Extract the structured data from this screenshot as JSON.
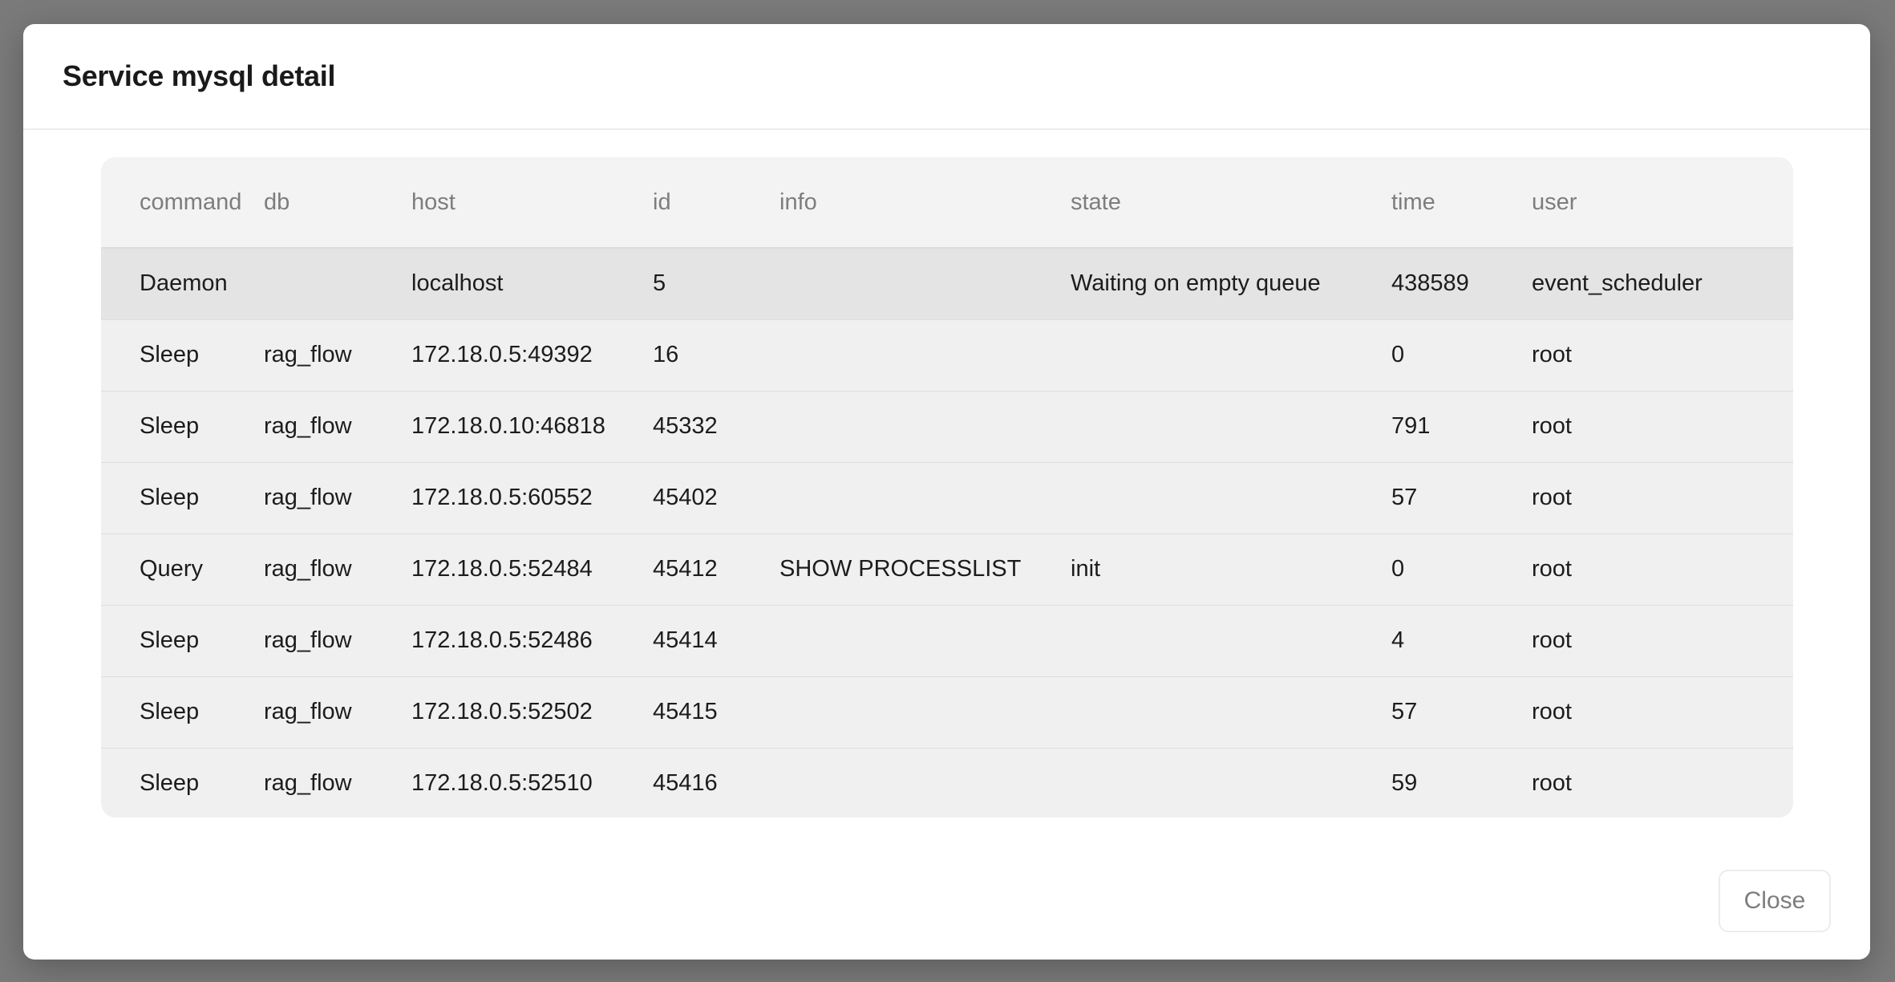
{
  "modal": {
    "title": "Service mysql detail",
    "close_label": "Close"
  },
  "table": {
    "columns": [
      "command",
      "db",
      "host",
      "id",
      "info",
      "state",
      "time",
      "user"
    ],
    "rows": [
      {
        "command": "Daemon",
        "db": "",
        "host": "localhost",
        "id": "5",
        "info": "",
        "state": "Waiting on empty queue",
        "time": "438589",
        "user": "event_scheduler"
      },
      {
        "command": "Sleep",
        "db": "rag_flow",
        "host": "172.18.0.5:49392",
        "id": "16",
        "info": "",
        "state": "",
        "time": "0",
        "user": "root"
      },
      {
        "command": "Sleep",
        "db": "rag_flow",
        "host": "172.18.0.10:46818",
        "id": "45332",
        "info": "",
        "state": "",
        "time": "791",
        "user": "root"
      },
      {
        "command": "Sleep",
        "db": "rag_flow",
        "host": "172.18.0.5:60552",
        "id": "45402",
        "info": "",
        "state": "",
        "time": "57",
        "user": "root"
      },
      {
        "command": "Query",
        "db": "rag_flow",
        "host": "172.18.0.5:52484",
        "id": "45412",
        "info": "SHOW PROCESSLIST",
        "state": "init",
        "time": "0",
        "user": "root"
      },
      {
        "command": "Sleep",
        "db": "rag_flow",
        "host": "172.18.0.5:52486",
        "id": "45414",
        "info": "",
        "state": "",
        "time": "4",
        "user": "root"
      },
      {
        "command": "Sleep",
        "db": "rag_flow",
        "host": "172.18.0.5:52502",
        "id": "45415",
        "info": "",
        "state": "",
        "time": "57",
        "user": "root"
      },
      {
        "command": "Sleep",
        "db": "rag_flow",
        "host": "172.18.0.5:52510",
        "id": "45416",
        "info": "",
        "state": "",
        "time": "59",
        "user": "root"
      }
    ]
  }
}
